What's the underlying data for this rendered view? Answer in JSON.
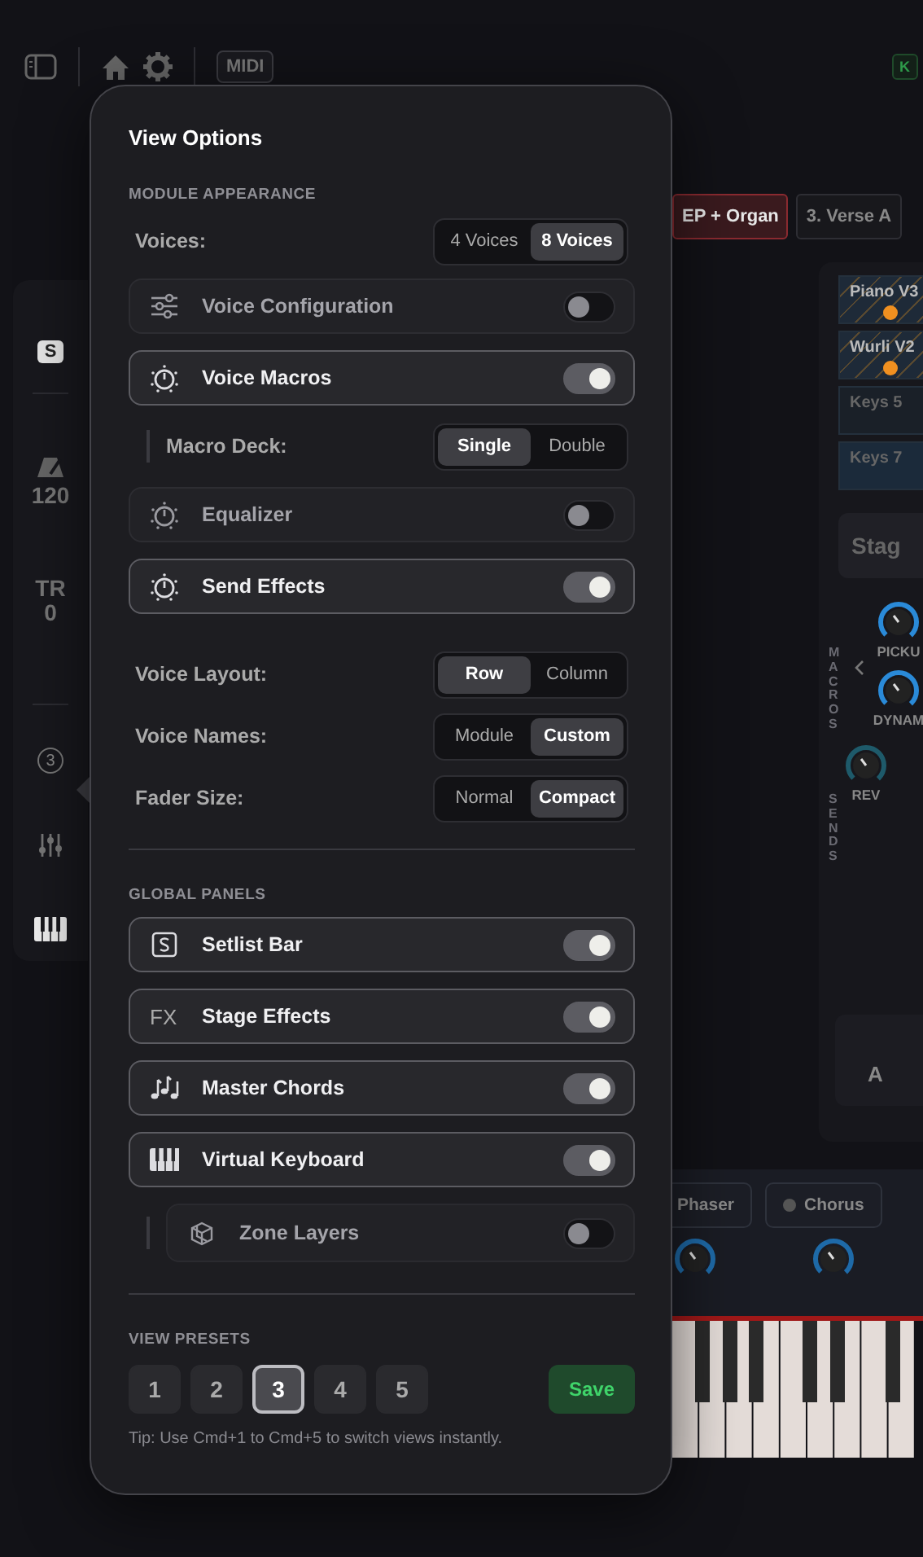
{
  "toolbar": {
    "midi": "MIDI",
    "badge": "K"
  },
  "rail": {
    "setlist": "S",
    "tempo": "120",
    "transpose_label": "TR",
    "transpose": "0",
    "view_number": "3"
  },
  "popover": {
    "title": "View Options",
    "sections": [
      {
        "heading": "MODULE APPEARANCE",
        "items": [
          {
            "kind": "segmented",
            "label": "Voices:",
            "options": [
              {
                "label": "4 Voices",
                "selected": false
              },
              {
                "label": "8 Voices",
                "selected": true
              }
            ]
          },
          {
            "kind": "toggle",
            "label": "Voice Configuration",
            "on": false
          },
          {
            "kind": "toggle",
            "label": "Voice Macros",
            "on": true
          },
          {
            "kind": "sub_segmented",
            "label": "Macro Deck:",
            "options": [
              {
                "label": "Single",
                "selected": true
              },
              {
                "label": "Double",
                "selected": false
              }
            ]
          },
          {
            "kind": "toggle",
            "label": "Equalizer",
            "on": false
          },
          {
            "kind": "toggle",
            "label": "Send Effects",
            "on": true
          },
          {
            "kind": "segmented",
            "label": "Voice Layout:",
            "options": [
              {
                "label": "Row",
                "selected": true
              },
              {
                "label": "Column",
                "selected": false
              }
            ]
          },
          {
            "kind": "segmented",
            "label": "Voice Names:",
            "options": [
              {
                "label": "Module",
                "selected": false
              },
              {
                "label": "Custom",
                "selected": true
              }
            ]
          },
          {
            "kind": "segmented",
            "label": "Fader Size:",
            "options": [
              {
                "label": "Normal",
                "selected": false
              },
              {
                "label": "Compact",
                "selected": true
              }
            ]
          }
        ]
      },
      {
        "heading": "GLOBAL PANELS",
        "items": [
          {
            "kind": "toggle",
            "label": "Setlist Bar",
            "on": true
          },
          {
            "kind": "toggle",
            "label": "Stage Effects",
            "on": true,
            "icon_text": "FX"
          },
          {
            "kind": "toggle",
            "label": "Master Chords",
            "on": true
          },
          {
            "kind": "toggle",
            "label": "Virtual Keyboard",
            "on": true
          },
          {
            "kind": "sub_toggle",
            "label": "Zone Layers",
            "on": false
          }
        ]
      }
    ],
    "presets": {
      "heading": "VIEW PRESETS",
      "buttons": [
        {
          "label": "1",
          "selected": false
        },
        {
          "label": "2",
          "selected": false
        },
        {
          "label": "3",
          "selected": true
        },
        {
          "label": "4",
          "selected": false
        },
        {
          "label": "5",
          "selected": false
        }
      ],
      "save": "Save",
      "tip": "Tip: Use Cmd+1 to Cmd+5 to switch views instantly."
    }
  },
  "stage": {
    "tabs": [
      {
        "label": "EP + Organ",
        "selected": true
      },
      {
        "label": "3. Verse A",
        "selected": false
      }
    ],
    "voices": [
      {
        "label": "Piano V3",
        "active": true
      },
      {
        "label": "Wurli V2",
        "active": true
      },
      {
        "label": "Keys 5",
        "active": false
      },
      {
        "label": "Keys 7",
        "active": false
      }
    ],
    "scene": "Stag",
    "macros_label": "MACROS",
    "knobs": [
      "PICKU",
      "DYNAM"
    ],
    "sends_label": "SENDS",
    "send_knob": "REV",
    "panel_letter": "A",
    "effects": [
      "Phaser",
      "Chorus"
    ]
  }
}
